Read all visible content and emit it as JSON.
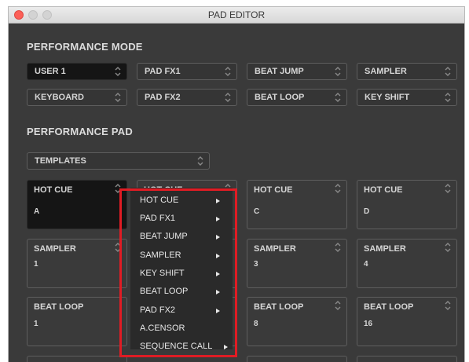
{
  "window": {
    "title": "PAD EDITOR"
  },
  "performance_mode": {
    "title": "PERFORMANCE MODE",
    "row1": [
      "USER 1",
      "PAD FX1",
      "BEAT JUMP",
      "SAMPLER"
    ],
    "row2": [
      "KEYBOARD",
      "PAD FX2",
      "BEAT LOOP",
      "KEY SHIFT"
    ]
  },
  "performance_pad": {
    "title": "PERFORMANCE PAD",
    "templates_label": "TEMPLATES",
    "row1": [
      {
        "name": "HOT CUE",
        "value": "A"
      },
      {
        "name": "HOT CUE",
        "value": ""
      },
      {
        "name": "HOT CUE",
        "value": "C"
      },
      {
        "name": "HOT CUE",
        "value": "D"
      }
    ],
    "row2": [
      {
        "name": "SAMPLER",
        "value": "1"
      },
      {
        "name": "",
        "value": ""
      },
      {
        "name": "SAMPLER",
        "value": "3"
      },
      {
        "name": "SAMPLER",
        "value": "4"
      }
    ],
    "row3": [
      {
        "name": "BEAT LOOP",
        "value": "1"
      },
      {
        "name": "",
        "value": ""
      },
      {
        "name": "BEAT LOOP",
        "value": "8"
      },
      {
        "name": "BEAT LOOP",
        "value": "16"
      }
    ]
  },
  "context_menu": {
    "items": [
      {
        "label": "HOT CUE",
        "submenu": true
      },
      {
        "label": "PAD FX1",
        "submenu": true
      },
      {
        "label": "BEAT JUMP",
        "submenu": true
      },
      {
        "label": "SAMPLER",
        "submenu": true
      },
      {
        "label": "KEY SHIFT",
        "submenu": true
      },
      {
        "label": "BEAT LOOP",
        "submenu": true
      },
      {
        "label": "PAD FX2",
        "submenu": true
      },
      {
        "label": "A.CENSOR",
        "submenu": false
      },
      {
        "label": "SEQUENCE CALL",
        "submenu": true
      }
    ]
  },
  "colors": {
    "background": "#3a3a3a",
    "highlight": "#e01c24",
    "text": "#d6d6d6"
  }
}
